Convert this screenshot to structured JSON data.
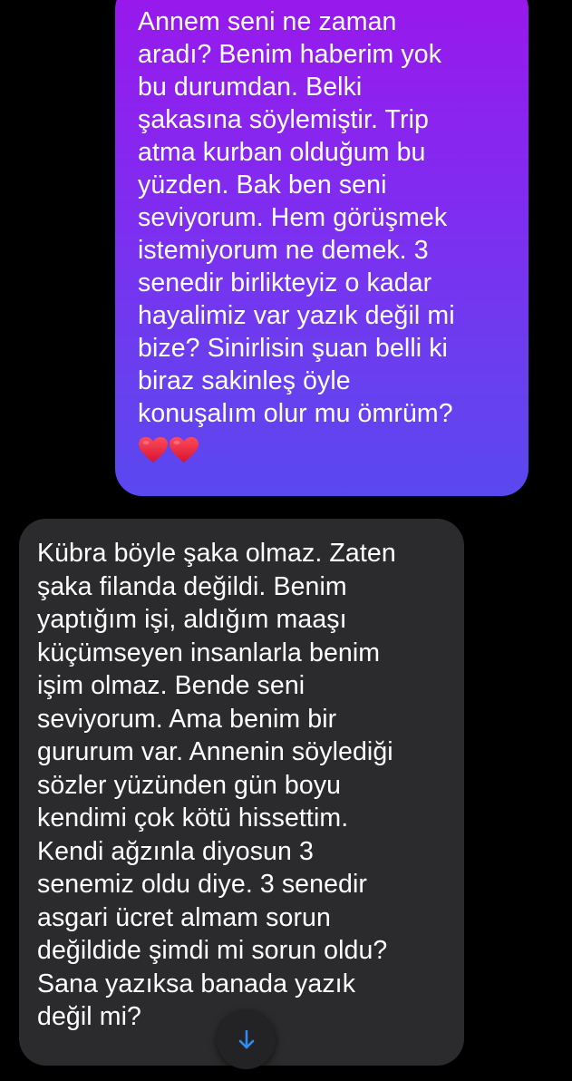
{
  "conversation": {
    "sent_message": {
      "text": "Annem seni ne zaman\naradı? Benim haberim yok\nbu durumdan. Belki\nşakasına söylemiştir. Trip\natma kurban olduğum bu\nyüzden. Bak ben seni\nseviyorum. Hem görüşmek\nistemiyorum ne demek. 3\nsenedir birlikteyiz o kadar\nhayalimiz var yazık değil mi\nbize? Sinirlisin şuan belli ki\nbiraz sakinleş öyle\nkonuşalım olur mu ömrüm?",
      "emoji_icons": [
        "red-heart-icon",
        "red-heart-icon"
      ]
    },
    "received_message": {
      "text": "Kübra böyle şaka olmaz. Zaten\nşaka filanda değildi. Benim\nyaptığım işi, aldığım maaşı\nküçümseyen insanlarla benim\nişim olmaz. Bende seni\nseviyorum. Ama benim bir\ngururum var. Annenin söylediği\nsözler yüzünden gün boyu\nkendimi çok kötü hissettim.\nKendi ağzınla diyosun 3\nsenemiz oldu diye. 3 senedir\nasgari ücret almam sorun\ndeğildide şimdi mi sorun oldu?\nSana yazıksa banada yazık\ndeğil mi?"
    }
  },
  "scroll_button": {
    "icon": "arrow-down-icon"
  },
  "colors": {
    "background": "#000000",
    "sent_gradient_top": "#9a17ec",
    "sent_gradient_bottom": "#5a48ef",
    "received_bubble": "#2b2b2d",
    "heart": "#e8223a",
    "arrow": "#2f8cf5"
  }
}
